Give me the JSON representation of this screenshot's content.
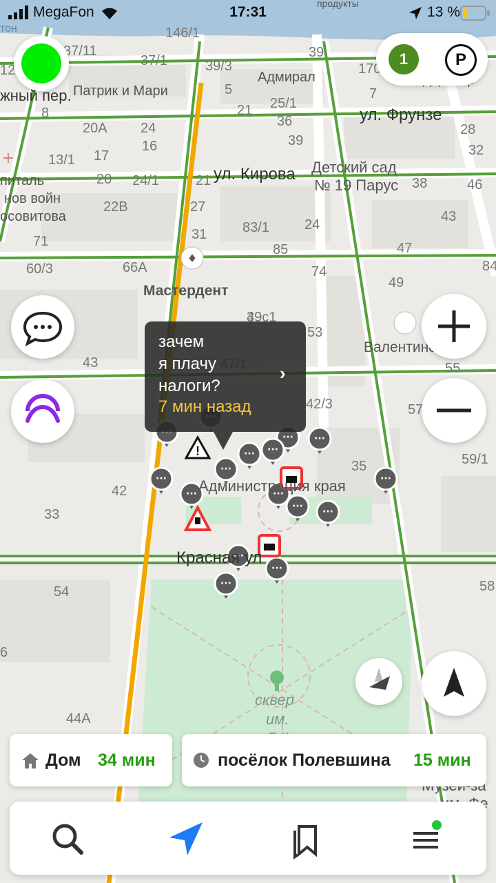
{
  "status_bar": {
    "carrier": "MegaFon",
    "time": "17:31",
    "battery": "13 %",
    "top_right_hint": "продукты",
    "top_left_hint": "тон"
  },
  "colors": {
    "traffic_green": "#00ee00",
    "badge_green": "#4e8c1f",
    "road_green": "#56a03a",
    "road_orange": "#f0a800",
    "accent_blue": "#1d7cf2",
    "time_green": "#24a00e",
    "bubble_time": "#f4c542"
  },
  "controls": {
    "traffic_icon": "traffic-light-indicator",
    "badge_count": "1",
    "parking_label": "P",
    "comment_icon": "chat-bubble-icon",
    "alice_icon": "alice-voice-assistant-icon",
    "zoom_in_icon": "plus-icon",
    "zoom_out_icon": "minus-icon",
    "compass_icon": "compass-icon",
    "location_icon": "navigation-arrow-icon"
  },
  "bubble": {
    "text": "зачем\nя плачу\nналоги?",
    "time": "7 мин назад"
  },
  "routes": [
    {
      "icon": "home-icon",
      "label": "Дом",
      "time": "34 мин"
    },
    {
      "icon": "clock-icon",
      "label": "посёлок Полевшина",
      "time": "15 мин"
    }
  ],
  "tabbar": {
    "search_icon": "search-icon",
    "route_icon": "navigation-arrow-icon",
    "bookmarks_icon": "bookmarks-icon",
    "menu_icon": "menu-icon"
  },
  "map_labels": {
    "streets": {
      "frunze": "ул. Фрунзе",
      "kirova": "ул. Кирова",
      "krasnaya": "Красная ул",
      "lane": "жный пер."
    },
    "pois": {
      "patrik": "Патрик и Мари",
      "admiral": "Адмирал",
      "direkhter": "Дирижер",
      "kindergarten_1": "Детский сад",
      "kindergarten_2": "№ 19 Парус",
      "hospital_1": "питаль",
      "hospital_2": "нов войн",
      "hospital_3": "осовитова",
      "masterdent": "Мастердент",
      "valentino": "Валентино",
      "admin": "Администрация края",
      "square_1": "сквер",
      "square_2": "им.",
      "square_3": "Б.К.",
      "museum_1": "Музей-за",
      "museum_2": "им. Фе"
    },
    "numbers": [
      "37/11",
      "37/1",
      "39/3",
      "146/1",
      "39",
      "170",
      "12",
      "5",
      "21",
      "25/1",
      "8",
      "20А",
      "24",
      "36",
      "7",
      "16",
      "39",
      "28",
      "32",
      "13/1",
      "17",
      "20",
      "24/1",
      "21",
      "38",
      "46",
      "27",
      "22В",
      "31",
      "83/1",
      "24",
      "43",
      "71",
      "60/3",
      "66А",
      "85",
      "74",
      "47",
      "84",
      "49",
      "39с1",
      "49",
      "53",
      "43",
      "47/1",
      "55",
      "42/3",
      "57",
      "35",
      "59/1",
      "42",
      "33",
      "54",
      "58",
      "44А",
      "56",
      "6"
    ]
  }
}
